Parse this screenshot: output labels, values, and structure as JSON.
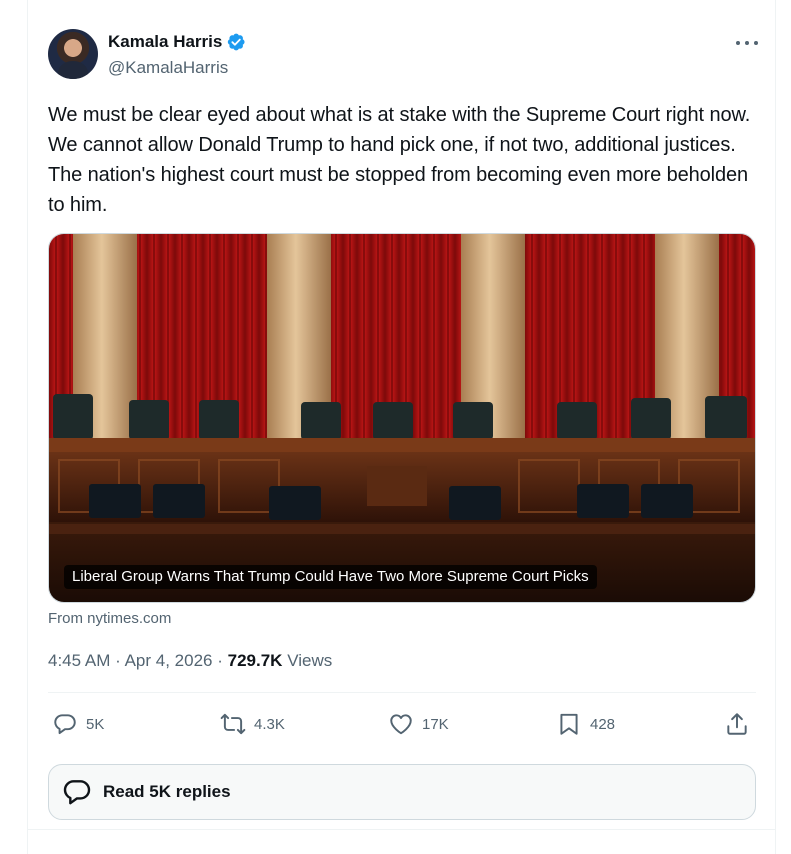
{
  "author": {
    "display_name": "Kamala Harris",
    "handle": "@KamalaHarris",
    "verified": true,
    "avatar_icon": "avatar-photo"
  },
  "tweet": {
    "text": "We must be clear eyed about what is at stake with the Supreme Court right now. We cannot allow Donald Trump to hand pick one, if not two, additional justices. The nation's highest court must be stopped from becoming even more beholden to him."
  },
  "card": {
    "title": "Liberal Group Warns That Trump Could Have Two More Supreme Court Picks",
    "source": "From nytimes.com",
    "image_icon": "supreme-court-chamber-photo"
  },
  "meta": {
    "time": "4:45 AM",
    "separator": "·",
    "date": "Apr 4, 2026",
    "views_count": "729.7K",
    "views_label": "Views"
  },
  "actions": {
    "reply": {
      "icon": "reply-icon",
      "count": "5K"
    },
    "retweet": {
      "icon": "retweet-icon",
      "count": "4.3K"
    },
    "like": {
      "icon": "heart-icon",
      "count": "17K"
    },
    "bookmark": {
      "icon": "bookmark-icon",
      "count": "428"
    },
    "share": {
      "icon": "share-icon"
    }
  },
  "read_replies": {
    "icon": "speech-bubble-icon",
    "label": "Read 5K replies"
  },
  "colors": {
    "text_primary": "#0f1419",
    "text_secondary": "#536471",
    "verified_blue": "#1d9bf0",
    "border": "#cfd9de"
  }
}
